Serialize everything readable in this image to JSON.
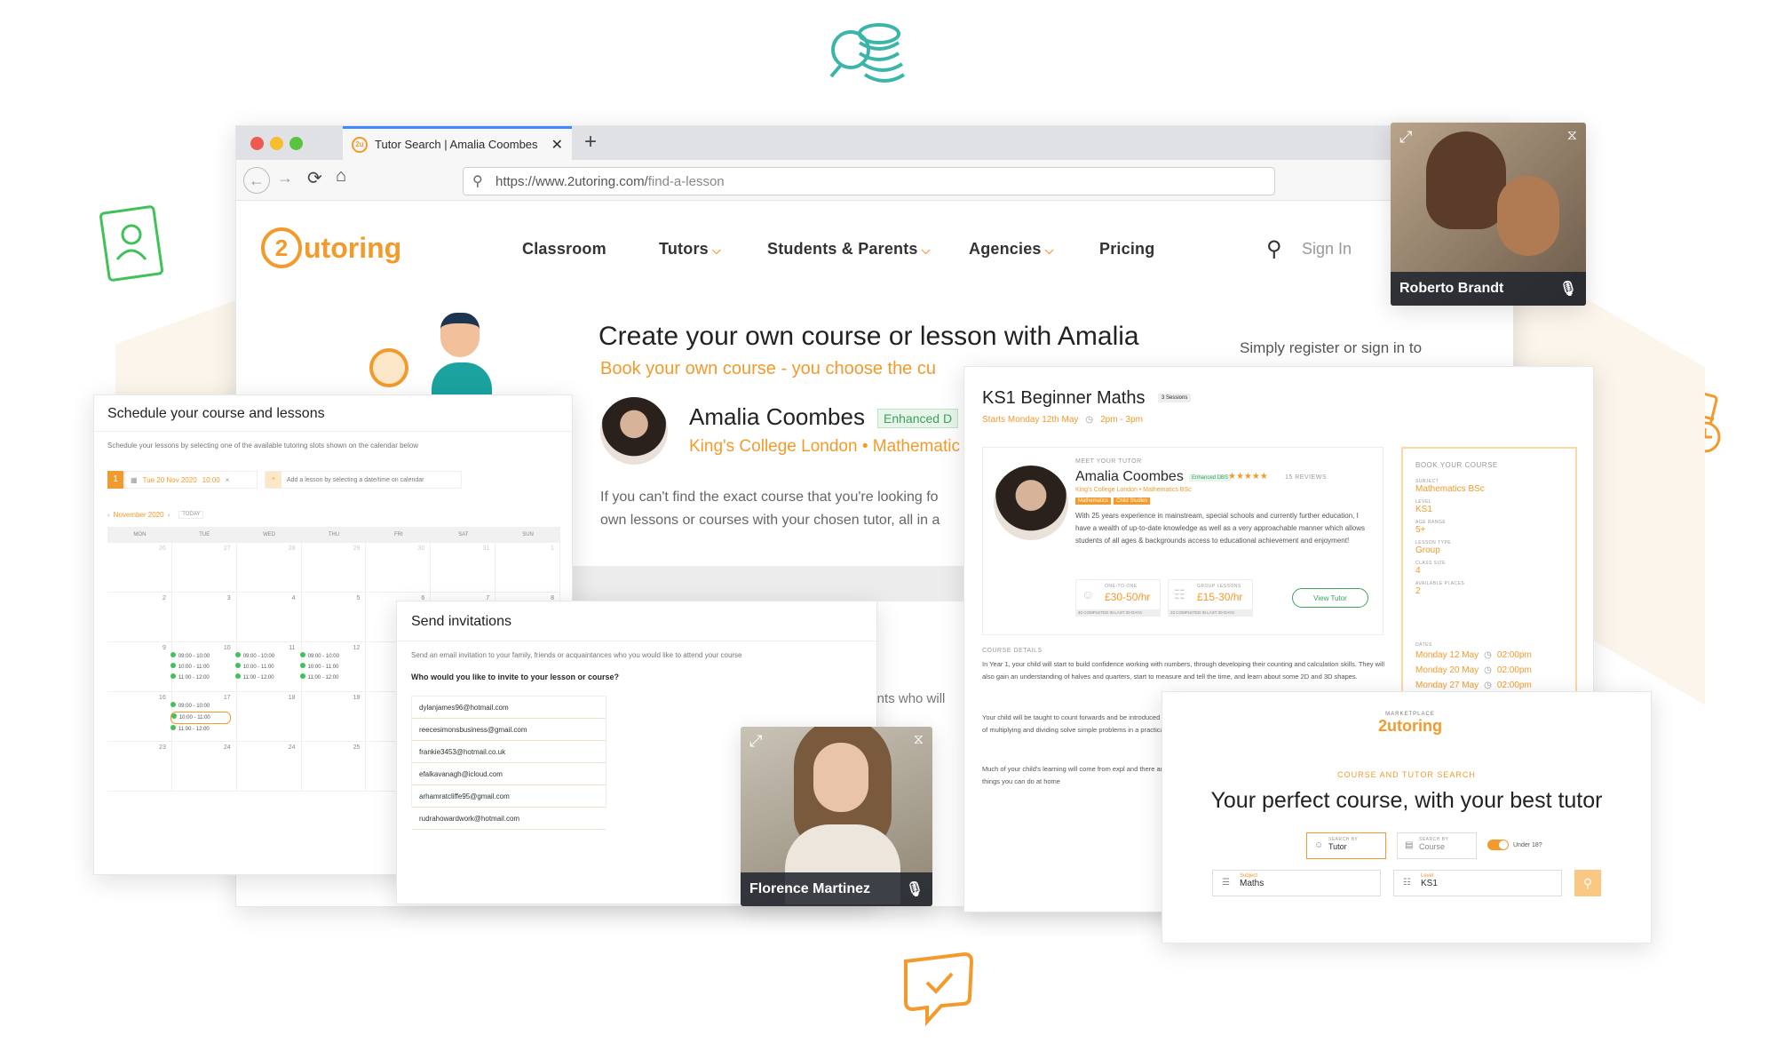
{
  "browser": {
    "tab_title": "Tutor Search | Amalia Coombes",
    "favicon_text": "2u",
    "url_host": "https://www.2utoring.com/",
    "url_path": "find-a-lesson"
  },
  "site": {
    "logo_digit": "2",
    "logo_text": "utoring",
    "nav": [
      "Classroom",
      "Tutors",
      "Students & Parents",
      "Agencies",
      "Pricing"
    ],
    "sign_in": "Sign In"
  },
  "hero": {
    "title": "Create your own course or lesson with Amalia",
    "subtitle": "Book your own course - you choose the cu",
    "tutor_name": "Amalia Coombes",
    "badge": "Enhanced D",
    "college": "King's College London • Mathematic",
    "desc_line1": "If you can't find the exact course that you're looking fo",
    "desc_line2": "own lessons or courses with your chosen tutor, all in a",
    "side_text": "Simply register or sign in to",
    "students_text": "dents who will"
  },
  "schedule": {
    "title": "Schedule your course and lessons",
    "description": "Schedule your lessons by selecting one of the available tutoring slots shown on the calendar below",
    "step": "1",
    "date": "Tue 20 Nov 2020",
    "time": "10:00",
    "add_lesson": "Add a lesson by selecting a date/time on calendar",
    "month": "November 2020",
    "today": "TODAY",
    "weekdays": [
      "MON",
      "TUE",
      "WED",
      "THU",
      "FRI",
      "SAT",
      "SUN"
    ],
    "week1": [
      "26",
      "27",
      "28",
      "29",
      "30",
      "31",
      "1"
    ],
    "week2": [
      "2",
      "3",
      "4",
      "5",
      "6",
      "7",
      "8"
    ],
    "week3": [
      "9",
      "10",
      "11",
      "12",
      "13",
      "14",
      "15"
    ],
    "week4": [
      "16",
      "17",
      "18",
      "19",
      "20",
      "21",
      "22"
    ],
    "week5": [
      "23",
      "24",
      "24",
      "25",
      "",
      "",
      ""
    ],
    "slots": [
      "09:00 - 10:00",
      "10:00 - 11:00",
      "11:00 - 12:00"
    ]
  },
  "invite": {
    "title": "Send invitations",
    "description": "Send an email invitation to your family, friends or acquaintances who you would like to attend your course",
    "question": "Who would you like to invite to your lesson or course?",
    "emails": [
      "dylanjames96@hotmail.com",
      "reecesimonsbusiness@gmail.com",
      "frankie3453@hotmail.co.uk",
      "efalkavanagh@icloud.com",
      "arhamratcliffe95@gmail.com",
      "rudrahowardwork@hotmail.com"
    ]
  },
  "video1": {
    "name": "Roberto Brandt"
  },
  "video2": {
    "name": "Florence Martinez"
  },
  "course": {
    "title": "KS1 Beginner Maths",
    "sessions": "3 Sessions",
    "starts": "Starts Monday 12th May",
    "time": "2pm - 3pm",
    "meet_label": "MEET YOUR TUTOR",
    "tutor_name": "Amalia Coombes",
    "enhanced": "Enhanced DBS",
    "reviews": "15 REVIEWS",
    "college": "King's College London • Mathematics BSc",
    "tags": [
      "Mathematics",
      "Child Studies"
    ],
    "bio": "With 25 years experience in mainstream, special schools and currently further education, I have a wealth of up-to-date knowledge as well as a very approachable manner which allows students of all ages & backgrounds access to educational achievement and enjoyment!",
    "one_to_one_label": "ONE-TO-ONE",
    "one_to_one_price": "£30-50/hr",
    "one_to_one_done": "40 COMPLETED IN LAST 30 DAYS",
    "group_label": "GROUP LESSONS",
    "group_price": "£15-30/hr",
    "group_done": "23 COMPLETED IN LAST 30 DAYS",
    "view_tutor": "View Tutor",
    "details_label": "COURSE DETAILS",
    "details_p1": "In Year 1, your child will start to build confidence working with numbers, through developing their counting and calculation skills. They will also gain an understanding of halves and quarters, start to measure and tell the time, and learn about some 2D and 3D shapes.",
    "details_p2": "Your child will be taught to count forwards and be introduced to the idea of multiplying and dividing solve simple problems in a practical way.",
    "details_p3": "Much of your child's learning will come from expl and there are simple things you can do at home",
    "book_label": "BOOK YOUR COURSE",
    "subject_label": "SUBJECT",
    "subject": "Mathematics BSc",
    "level_label": "LEVEL",
    "level": "KS1",
    "age_label": "AGE RANGE",
    "age": "5+",
    "type_label": "LESSON TYPE",
    "type": "Group",
    "class_label": "CLASS SIZE",
    "class_size": "4",
    "places_label": "AVAILABLE PLACES",
    "places": "2",
    "dates_label": "DATES",
    "dates": [
      "Monday 12 May",
      "Monday 20 May",
      "Monday 27 May"
    ],
    "date_time": "02:00pm"
  },
  "search": {
    "marketplace": "MARKETPLACE",
    "logo_text": "2utoring",
    "section_label": "COURSE AND TUTOR SEARCH",
    "heading": "Your perfect course, with your best tutor",
    "search_by_label": "SEARCH BY",
    "tutor": "Tutor",
    "course": "Course",
    "under18": "Under 18?",
    "subject_label": "Subject",
    "subject": "Maths",
    "level_label": "Level",
    "level": "KS1"
  },
  "colors": {
    "accent": "#f39a2c",
    "teal": "#3bb5a8",
    "green": "#41c15a"
  }
}
